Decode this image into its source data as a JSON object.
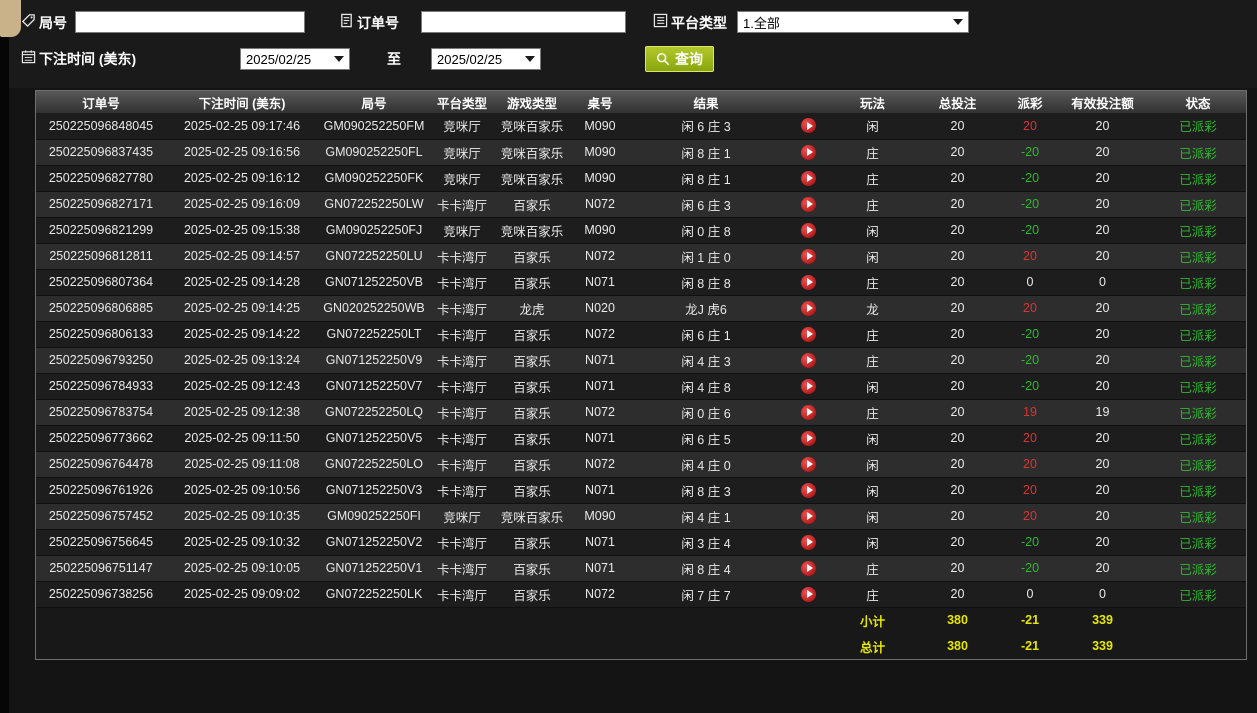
{
  "filters": {
    "round": {
      "label": "局号",
      "value": ""
    },
    "order": {
      "label": "订单号",
      "value": ""
    },
    "platform": {
      "label": "平台类型",
      "value": "1.全部"
    },
    "bet_time": {
      "label": "下注时间 (美东)",
      "from": "2025/02/25",
      "to_label": "至",
      "to": "2025/02/25"
    },
    "query_label": "查询"
  },
  "table": {
    "headers": [
      "订单号",
      "下注时间 (美东)",
      "局号",
      "平台类型",
      "游戏类型",
      "桌号",
      "结果",
      "",
      "玩法",
      "总投注",
      "派彩",
      "有效投注额",
      "状态"
    ],
    "rows": [
      {
        "order": "250225096848045",
        "time": "2025-02-25 09:17:46",
        "round": "GM090252250FM",
        "platform": "竞咪厅",
        "game": "竞咪百家乐",
        "table_no": "M090",
        "result": "闲 6 庄 3",
        "play": "闲",
        "total_bet": "20",
        "payout": "20",
        "valid_bet": "20",
        "status": "已派彩"
      },
      {
        "order": "250225096837435",
        "time": "2025-02-25 09:16:56",
        "round": "GM090252250FL",
        "platform": "竞咪厅",
        "game": "竞咪百家乐",
        "table_no": "M090",
        "result": "闲 8 庄 1",
        "play": "庄",
        "total_bet": "20",
        "payout": "-20",
        "valid_bet": "20",
        "status": "已派彩"
      },
      {
        "order": "250225096827780",
        "time": "2025-02-25 09:16:12",
        "round": "GM090252250FK",
        "platform": "竞咪厅",
        "game": "竞咪百家乐",
        "table_no": "M090",
        "result": "闲 8 庄 1",
        "play": "庄",
        "total_bet": "20",
        "payout": "-20",
        "valid_bet": "20",
        "status": "已派彩"
      },
      {
        "order": "250225096827171",
        "time": "2025-02-25 09:16:09",
        "round": "GN072252250LW",
        "platform": "卡卡湾厅",
        "game": "百家乐",
        "table_no": "N072",
        "result": "闲 6 庄 3",
        "play": "庄",
        "total_bet": "20",
        "payout": "-20",
        "valid_bet": "20",
        "status": "已派彩"
      },
      {
        "order": "250225096821299",
        "time": "2025-02-25 09:15:38",
        "round": "GM090252250FJ",
        "platform": "竞咪厅",
        "game": "竞咪百家乐",
        "table_no": "M090",
        "result": "闲 0 庄 8",
        "play": "闲",
        "total_bet": "20",
        "payout": "-20",
        "valid_bet": "20",
        "status": "已派彩"
      },
      {
        "order": "250225096812811",
        "time": "2025-02-25 09:14:57",
        "round": "GN072252250LU",
        "platform": "卡卡湾厅",
        "game": "百家乐",
        "table_no": "N072",
        "result": "闲 1 庄 0",
        "play": "闲",
        "total_bet": "20",
        "payout": "20",
        "valid_bet": "20",
        "status": "已派彩"
      },
      {
        "order": "250225096807364",
        "time": "2025-02-25 09:14:28",
        "round": "GN071252250VB",
        "platform": "卡卡湾厅",
        "game": "百家乐",
        "table_no": "N071",
        "result": "闲 8 庄 8",
        "play": "庄",
        "total_bet": "20",
        "payout": "0",
        "valid_bet": "0",
        "status": "已派彩"
      },
      {
        "order": "250225096806885",
        "time": "2025-02-25 09:14:25",
        "round": "GN020252250WB",
        "platform": "卡卡湾厅",
        "game": "龙虎",
        "table_no": "N020",
        "result": "龙J 虎6",
        "play": "龙",
        "total_bet": "20",
        "payout": "20",
        "valid_bet": "20",
        "status": "已派彩"
      },
      {
        "order": "250225096806133",
        "time": "2025-02-25 09:14:22",
        "round": "GN072252250LT",
        "platform": "卡卡湾厅",
        "game": "百家乐",
        "table_no": "N072",
        "result": "闲 6 庄 1",
        "play": "庄",
        "total_bet": "20",
        "payout": "-20",
        "valid_bet": "20",
        "status": "已派彩"
      },
      {
        "order": "250225096793250",
        "time": "2025-02-25 09:13:24",
        "round": "GN071252250V9",
        "platform": "卡卡湾厅",
        "game": "百家乐",
        "table_no": "N071",
        "result": "闲 4 庄 3",
        "play": "庄",
        "total_bet": "20",
        "payout": "-20",
        "valid_bet": "20",
        "status": "已派彩"
      },
      {
        "order": "250225096784933",
        "time": "2025-02-25 09:12:43",
        "round": "GN071252250V7",
        "platform": "卡卡湾厅",
        "game": "百家乐",
        "table_no": "N071",
        "result": "闲 4 庄 8",
        "play": "闲",
        "total_bet": "20",
        "payout": "-20",
        "valid_bet": "20",
        "status": "已派彩"
      },
      {
        "order": "250225096783754",
        "time": "2025-02-25 09:12:38",
        "round": "GN072252250LQ",
        "platform": "卡卡湾厅",
        "game": "百家乐",
        "table_no": "N072",
        "result": "闲 0 庄 6",
        "play": "庄",
        "total_bet": "20",
        "payout": "19",
        "valid_bet": "19",
        "status": "已派彩"
      },
      {
        "order": "250225096773662",
        "time": "2025-02-25 09:11:50",
        "round": "GN071252250V5",
        "platform": "卡卡湾厅",
        "game": "百家乐",
        "table_no": "N071",
        "result": "闲 6 庄 5",
        "play": "闲",
        "total_bet": "20",
        "payout": "20",
        "valid_bet": "20",
        "status": "已派彩"
      },
      {
        "order": "250225096764478",
        "time": "2025-02-25 09:11:08",
        "round": "GN072252250LO",
        "platform": "卡卡湾厅",
        "game": "百家乐",
        "table_no": "N072",
        "result": "闲 4 庄 0",
        "play": "闲",
        "total_bet": "20",
        "payout": "20",
        "valid_bet": "20",
        "status": "已派彩"
      },
      {
        "order": "250225096761926",
        "time": "2025-02-25 09:10:56",
        "round": "GN071252250V3",
        "platform": "卡卡湾厅",
        "game": "百家乐",
        "table_no": "N071",
        "result": "闲 8 庄 3",
        "play": "闲",
        "total_bet": "20",
        "payout": "20",
        "valid_bet": "20",
        "status": "已派彩"
      },
      {
        "order": "250225096757452",
        "time": "2025-02-25 09:10:35",
        "round": "GM090252250FI",
        "platform": "竞咪厅",
        "game": "竞咪百家乐",
        "table_no": "M090",
        "result": "闲 4 庄 1",
        "play": "闲",
        "total_bet": "20",
        "payout": "20",
        "valid_bet": "20",
        "status": "已派彩"
      },
      {
        "order": "250225096756645",
        "time": "2025-02-25 09:10:32",
        "round": "GN071252250V2",
        "platform": "卡卡湾厅",
        "game": "百家乐",
        "table_no": "N071",
        "result": "闲 3 庄 4",
        "play": "闲",
        "total_bet": "20",
        "payout": "-20",
        "valid_bet": "20",
        "status": "已派彩"
      },
      {
        "order": "250225096751147",
        "time": "2025-02-25 09:10:05",
        "round": "GN071252250V1",
        "platform": "卡卡湾厅",
        "game": "百家乐",
        "table_no": "N071",
        "result": "闲 8 庄 4",
        "play": "庄",
        "total_bet": "20",
        "payout": "-20",
        "valid_bet": "20",
        "status": "已派彩"
      },
      {
        "order": "250225096738256",
        "time": "2025-02-25 09:09:02",
        "round": "GN072252250LK",
        "platform": "卡卡湾厅",
        "game": "百家乐",
        "table_no": "N072",
        "result": "闲 7 庄 7",
        "play": "庄",
        "total_bet": "20",
        "payout": "0",
        "valid_bet": "0",
        "status": "已派彩"
      }
    ],
    "subtotal": {
      "label": "小计",
      "total_bet": "380",
      "payout": "-21",
      "valid_bet": "339"
    },
    "grand_total": {
      "label": "总计",
      "total_bet": "380",
      "payout": "-21",
      "valid_bet": "339"
    }
  },
  "colors": {
    "win_red": "#d83434",
    "lose_green": "#2eb82e",
    "status_green": "#2eb82e",
    "summary_yellow": "#e6e600",
    "button_accent": "#8aa50e",
    "button_highlight": "#b2c92c"
  }
}
